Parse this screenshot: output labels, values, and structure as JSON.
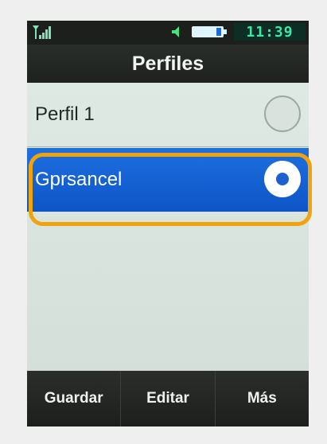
{
  "status": {
    "time": "11:39",
    "icons": [
      "signal-icon",
      "speaker-icon",
      "battery-icon"
    ]
  },
  "header": {
    "title": "Perfiles"
  },
  "profiles": [
    {
      "label": "Perfil 1",
      "selected": false
    },
    {
      "label": "Gprsancel",
      "selected": true
    }
  ],
  "softkeys": {
    "left": "Guardar",
    "center": "Editar",
    "right": "Más"
  },
  "colors": {
    "accent_selected": "#0d55c7",
    "highlight_outline": "#f0a30a",
    "clock_text": "#3fe6a7"
  }
}
